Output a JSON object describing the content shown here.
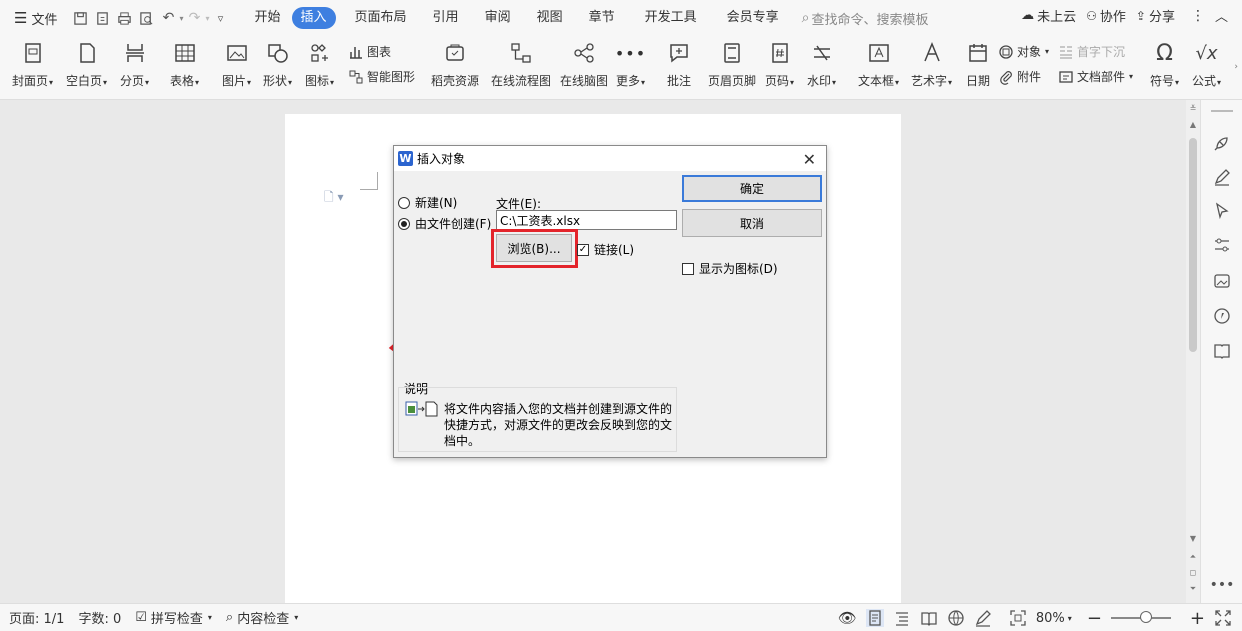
{
  "menubar": {
    "file": "文件",
    "tabs": [
      "开始",
      "插入",
      "页面布局",
      "引用",
      "审阅",
      "视图",
      "章节",
      "开发工具",
      "会员专享"
    ],
    "active_tab": "插入",
    "search_placeholder": "查找命令、搜索模板",
    "cloud": "未上云",
    "collab": "协作",
    "share": "分享"
  },
  "ribbon": {
    "cover": "封面页",
    "blank": "空白页",
    "pagebreak": "分页",
    "table": "表格",
    "picture": "图片",
    "shape": "形状",
    "icons": "图标",
    "chart": "图表",
    "smartart": "智能图形",
    "docer": "稻壳资源",
    "flowchart": "在线流程图",
    "mindmap": "在线脑图",
    "more": "更多",
    "comment": "批注",
    "header_footer": "页眉页脚",
    "page_number": "页码",
    "watermark": "水印",
    "textbox": "文本框",
    "wordart": "艺术字",
    "date": "日期",
    "object": "对象",
    "dropcap": "首字下沉",
    "attachment": "附件",
    "docparts": "文档部件",
    "symbol": "符号",
    "formula": "公式"
  },
  "dialog": {
    "title": "插入对象",
    "radio_new": "新建(N)",
    "radio_from_file": "由文件创建(F)",
    "file_label": "文件(E):",
    "file_value": "C:\\工资表.xlsx",
    "browse": "浏览(B)...",
    "link": "链接(L)",
    "ok": "确定",
    "cancel": "取消",
    "show_as_icon": "显示为图标(D)",
    "desc_label": "说明",
    "desc_text": "将文件内容插入您的文档并创建到源文件的快捷方式，对源文件的更改会反映到您的文档中。",
    "link_checked": true,
    "show_as_icon_checked": false,
    "selected_radio": "from_file"
  },
  "statusbar": {
    "page": "页面: 1/1",
    "words": "字数: 0",
    "spellcheck": "拼写检查",
    "content_check": "内容检查",
    "zoom": "80%"
  },
  "colors": {
    "accent": "#3e7fe0",
    "highlight_red": "#e3242b",
    "arrow_red": "#e3242b"
  }
}
